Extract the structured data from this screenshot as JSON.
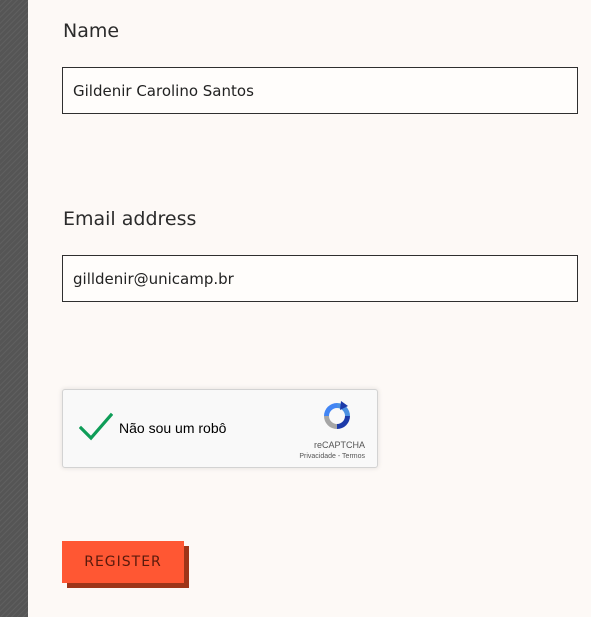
{
  "form": {
    "name": {
      "label": "Name",
      "value": "Gildenir Carolino Santos"
    },
    "email": {
      "label": "Email address",
      "value": "gilldenir@unicamp.br"
    },
    "recaptcha": {
      "checkbox_label": "Não sou um robô",
      "checked": true,
      "brand": "reCAPTCHA",
      "privacy_link": "Privacidade",
      "separator": " - ",
      "terms_link": "Termos",
      "check_color": "#0f9d58"
    },
    "register_label": "REGISTER"
  },
  "colors": {
    "panel_background": "#fdf9f6",
    "register_button": "#ff5733",
    "register_shadow": "#9e3519",
    "page_background": "#555555"
  },
  "icons": {
    "checkmark": "checkmark-icon",
    "recaptcha_logo": "recaptcha-logo-icon"
  }
}
